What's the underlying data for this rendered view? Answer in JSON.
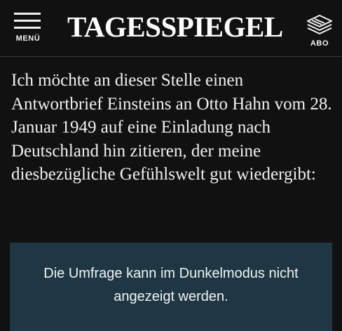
{
  "header": {
    "menu_label": "MENÜ",
    "logo_text": "TAGESSPIEGEL",
    "abo_label": "ABO",
    "menu_icon": "hamburger-menu-icon",
    "abo_icon": "newspaper-stack-icon"
  },
  "article": {
    "paragraph": "Ich möchte an dieser Stelle einen Antwortbrief Einsteins an Otto Hahn vom 28. Januar 1949 auf eine Einladung nach Deutschland hin zitieren, der meine diesbezügliche Gefühlswelt gut wiedergibt:"
  },
  "poll_notice": {
    "text": "Die Umfrage kann im Dunkelmodus nicht angezeigt werden.",
    "background_color": "#1f3744"
  },
  "colors": {
    "background": "#111111",
    "text": "#f2f2f2"
  }
}
